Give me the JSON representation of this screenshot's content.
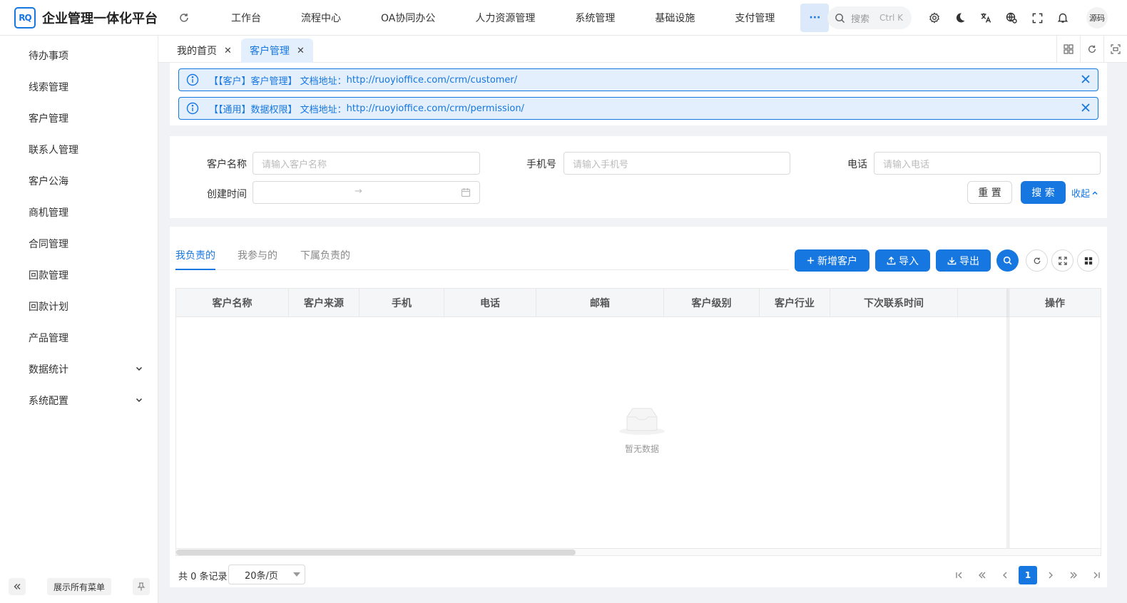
{
  "app": {
    "logo_text": "RQ",
    "title": "企业管理一体化平台"
  },
  "topnav": {
    "items": [
      "工作台",
      "流程中心",
      "OA协同办公",
      "人力资源管理",
      "系统管理",
      "基础设施",
      "支付管理"
    ],
    "more": "···"
  },
  "top_search": {
    "placeholder": "搜索",
    "shortcut": "Ctrl K"
  },
  "top_icons": [
    "gear-icon",
    "moon-icon",
    "translate-icon",
    "globe-icon",
    "fullscreen-icon",
    "bell-icon"
  ],
  "user": {
    "name": "源码"
  },
  "sidebar": {
    "items": [
      {
        "label": "待办事项"
      },
      {
        "label": "线索管理"
      },
      {
        "label": "客户管理"
      },
      {
        "label": "联系人管理"
      },
      {
        "label": "客户公海"
      },
      {
        "label": "商机管理"
      },
      {
        "label": "合同管理"
      },
      {
        "label": "回款管理"
      },
      {
        "label": "回款计划"
      },
      {
        "label": "产品管理"
      },
      {
        "label": "数据统计"
      },
      {
        "label": "系统配置"
      }
    ],
    "show_all": "展示所有菜单"
  },
  "tabs": [
    {
      "label": "我的首页",
      "active": false
    },
    {
      "label": "客户管理",
      "active": true
    }
  ],
  "alerts": [
    {
      "prefix": "【【客户】客户管理】 文档地址：",
      "url": "http://ruoyioffice.com/crm/customer/"
    },
    {
      "prefix": "【【通用】数据权限】 文档地址：",
      "url": "http://ruoyioffice.com/crm/permission/"
    }
  ],
  "search_form": {
    "name_label": "客户名称",
    "name_placeholder": "请输入客户名称",
    "mobile_label": "手机号",
    "mobile_placeholder": "请输入手机号",
    "phone_label": "电话",
    "phone_placeholder": "请输入电话",
    "created_label": "创建时间",
    "range_separator": "→",
    "reset": "重 置",
    "search": "搜 索",
    "collapse": "收起"
  },
  "subtabs": [
    "我负责的",
    "我参与的",
    "下属负责的"
  ],
  "toolbar": {
    "add": "新增客户",
    "import": "导入",
    "export": "导出"
  },
  "table": {
    "columns": [
      "客户名称",
      "客户来源",
      "手机",
      "电话",
      "邮箱",
      "客户级别",
      "客户行业",
      "下次联系时间",
      "操作"
    ],
    "rows": [],
    "empty_text": "暂无数据"
  },
  "pagination": {
    "total_text": "共 0 条记录",
    "page_size": "20条/页",
    "current_page": "1"
  },
  "colors": {
    "primary": "#1677e0",
    "alert_bg": "#e3effd"
  }
}
